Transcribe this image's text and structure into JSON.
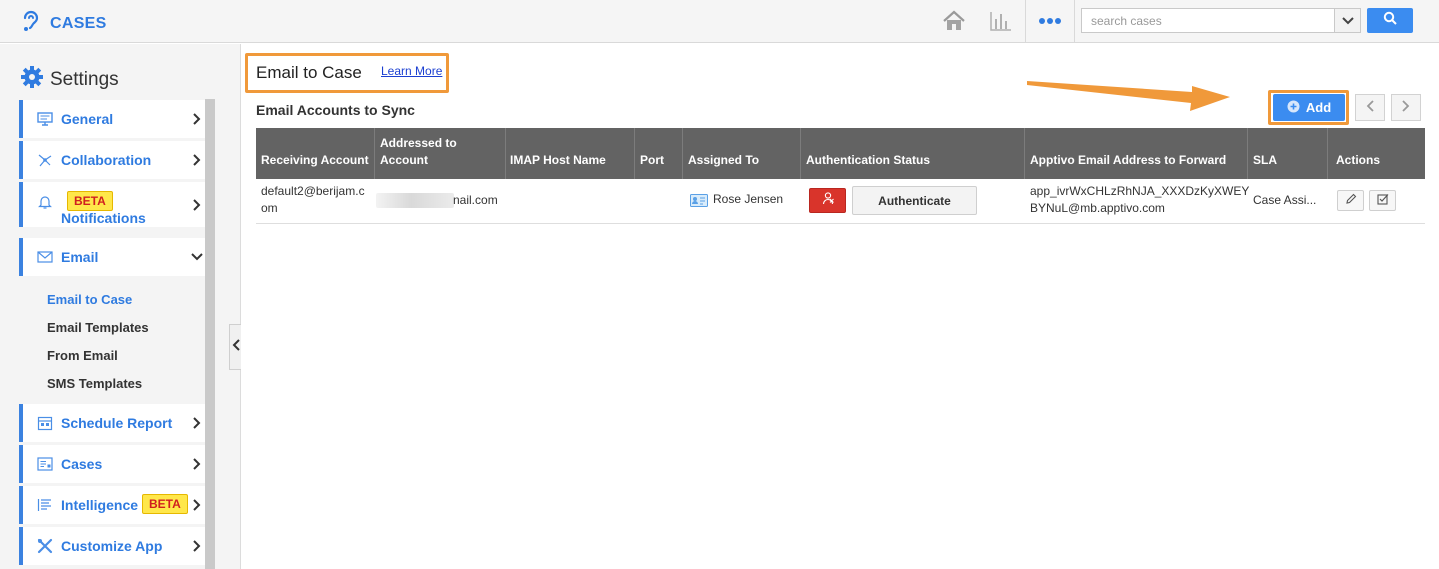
{
  "app": {
    "name": "CASES",
    "brand_color": "#2f7be0"
  },
  "topbar": {
    "icons": [
      "home-icon",
      "bar-chart-icon",
      "more-dots-icon"
    ],
    "search": {
      "placeholder": "search cases",
      "value": ""
    }
  },
  "sidebar": {
    "title": "Settings",
    "items": [
      {
        "label": "General",
        "icon": "monitor-icon"
      },
      {
        "label": "Collaboration",
        "icon": "network-icon"
      },
      {
        "label": "Notifications",
        "icon": "bell-icon",
        "badge": "BETA"
      },
      {
        "label": "Email",
        "icon": "envelope-icon",
        "expanded": true
      },
      {
        "label": "Schedule Report",
        "icon": "calendar-icon"
      },
      {
        "label": "Cases",
        "icon": "list-card-icon"
      },
      {
        "label": "Intelligence",
        "icon": "text-lines-icon",
        "badge": "BETA"
      },
      {
        "label": "Customize App",
        "icon": "tools-icon"
      }
    ],
    "email_subitems": [
      {
        "label": "Email to Case",
        "active": true
      },
      {
        "label": "Email Templates",
        "active": false
      },
      {
        "label": "From Email",
        "active": false
      },
      {
        "label": "SMS Templates",
        "active": false
      }
    ]
  },
  "main": {
    "title": "Email to Case",
    "learn_more": "Learn More",
    "section_title": "Email Accounts to Sync",
    "add_label": "Add",
    "table": {
      "headers": [
        "Receiving Account",
        "Addressed to Account",
        "IMAP Host Name",
        "Port",
        "Assigned To",
        "Authentication Status",
        "Apptivo Email Address to Forward",
        "SLA",
        "Actions"
      ],
      "rows": [
        {
          "receiving_account": "default2@berijam.com",
          "addressed_to_suffix": "nail.com",
          "imap_host": "",
          "port": "",
          "assigned_to": "Rose Jensen",
          "auth_button": "Authenticate",
          "forward_address": "app_ivrWxCHLzRhNJA_XXXDzKyXWEYBYNuL@mb.apptivo.com",
          "sla": "Case Assi..."
        }
      ]
    }
  },
  "colors": {
    "accent": "#3b8cf0",
    "highlight": "#f0993a",
    "table_header": "#636363",
    "danger": "#d9342b",
    "beta_bg": "#ffe74a"
  }
}
